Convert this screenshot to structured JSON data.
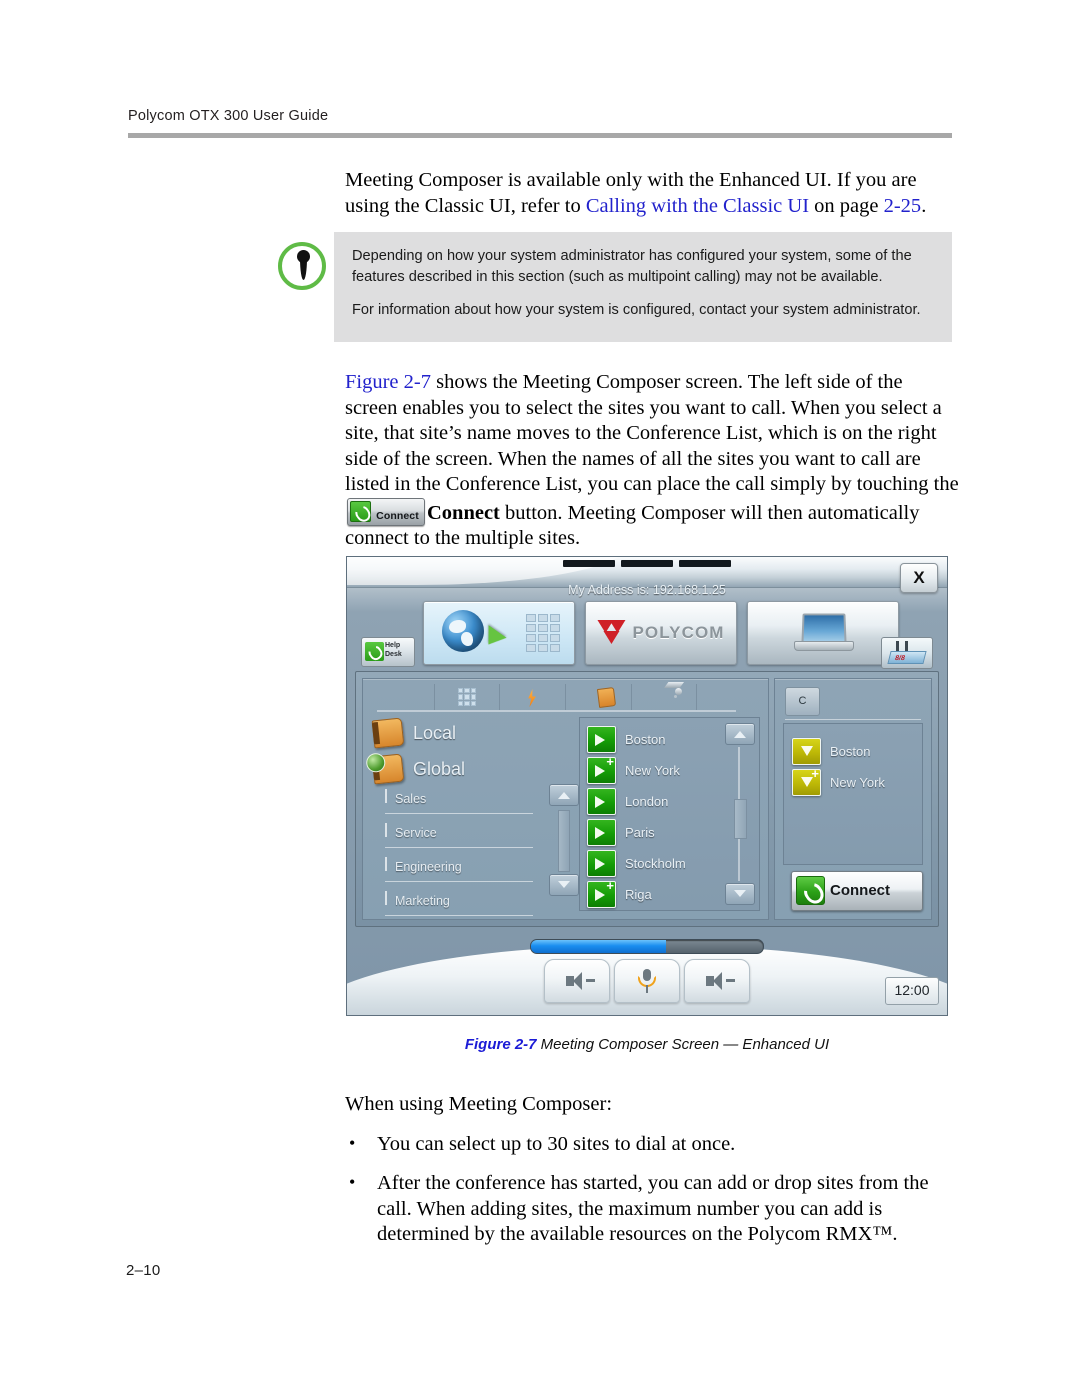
{
  "header": {
    "running_head": "Polycom OTX 300 User Guide"
  },
  "intro": {
    "line1": "Meeting Composer is available only with the Enhanced UI. If you are using the",
    "line2_prefix": "Classic UI, refer to ",
    "link_text": "Calling with the Classic UI",
    "line2_mid": " on page ",
    "page_ref": "2-25",
    "line2_suffix": "."
  },
  "note": {
    "icon": "caution-pin-icon",
    "paragraph1": "Depending on how your system administrator has configured your system, some of the features described in this section (such as multipoint calling) may not be available.",
    "paragraph2": "For information about how your system is configured, contact your system administrator."
  },
  "figure_para": {
    "fig_ref": "Figure 2-7",
    "text_before": " shows the Meeting Composer screen. The left side of the screen enables you to select the sites you want to call. When you select a site, that site’s name moves to the Conference List, which is on the right side of the screen. When the names of all the sites you want to call are listed in the Conference List, you can place the call simply by touching the ",
    "inline_button_label": "Connect",
    "bold_word": "Connect",
    "text_after": " button. Meeting Composer will then automatically connect to the multiple sites."
  },
  "device": {
    "address_line": "My Address is: 192.168.1.25",
    "close_button": "X",
    "help_desk_button": "Help Desk",
    "help_desk_line1": "Help",
    "help_desk_line2": "Desk",
    "calendar_day": "8/8",
    "brand": "POLYCOM",
    "tabs": [
      {
        "name": "blank-tab",
        "icon": "blank-icon"
      },
      {
        "name": "keypad-tab",
        "icon": "keypad-icon"
      },
      {
        "name": "speed-dial-tab",
        "icon": "lightning-bolt-icon"
      },
      {
        "name": "directory-tab",
        "icon": "address-book-icon"
      },
      {
        "name": "camera-tab",
        "icon": "camera-icon"
      },
      {
        "name": "blank-tab-2",
        "icon": "blank-icon"
      }
    ],
    "directories": [
      {
        "label": "Local",
        "icon": "book-icon"
      },
      {
        "label": "Global",
        "icon": "globe-book-icon"
      }
    ],
    "groups": [
      "Sales",
      "Service",
      "Engineering",
      "Marketing"
    ],
    "sites": [
      {
        "name": "Boston",
        "icon": "green-dial-icon",
        "plus": false
      },
      {
        "name": "New York",
        "icon": "green-dial-plus-icon",
        "plus": true
      },
      {
        "name": "London",
        "icon": "green-dial-icon",
        "plus": false
      },
      {
        "name": "Paris",
        "icon": "green-dial-icon",
        "plus": false
      },
      {
        "name": "Stockholm",
        "icon": "green-dial-icon",
        "plus": false
      },
      {
        "name": "Riga",
        "icon": "green-dial-plus-icon",
        "plus": true
      }
    ],
    "conference": {
      "tab_label": "C",
      "entries": [
        {
          "name": "Boston",
          "icon": "yellow-drop-icon",
          "plus": false
        },
        {
          "name": "New York",
          "icon": "yellow-drop-plus-icon",
          "plus": true
        }
      ],
      "connect_label": "Connect"
    },
    "volume_percent": 58,
    "bottom_keys": [
      {
        "name": "volume-down-key",
        "icon": "speaker-minus-icon"
      },
      {
        "name": "mute-key",
        "icon": "microphone-icon"
      },
      {
        "name": "volume-up-key",
        "icon": "speaker-plus-icon"
      }
    ],
    "clock": "12:00"
  },
  "caption": {
    "figure_number": "Figure 2-7",
    "text": "  Meeting Composer Screen — Enhanced UI"
  },
  "closing": {
    "lead_in": "When using Meeting Composer:",
    "bullets": [
      "You can select up to 30 sites to dial at once.",
      "After the conference has started, you can add or drop sites from the call. When adding sites, the maximum number you can add is determined by the available resources on the Polycom RMX™."
    ]
  },
  "folio": "2–10",
  "colors": {
    "link": "#2222cc",
    "figure_ref": "#1b1bd6",
    "note_bg": "#dededf",
    "note_ring": "#5fbb46",
    "rule": "#a8a8a8",
    "green_icon": "#149c06",
    "yellow_icon": "#bdb806",
    "polycom_red": "#cf2027",
    "volume_blue": "#1a8ef0"
  }
}
